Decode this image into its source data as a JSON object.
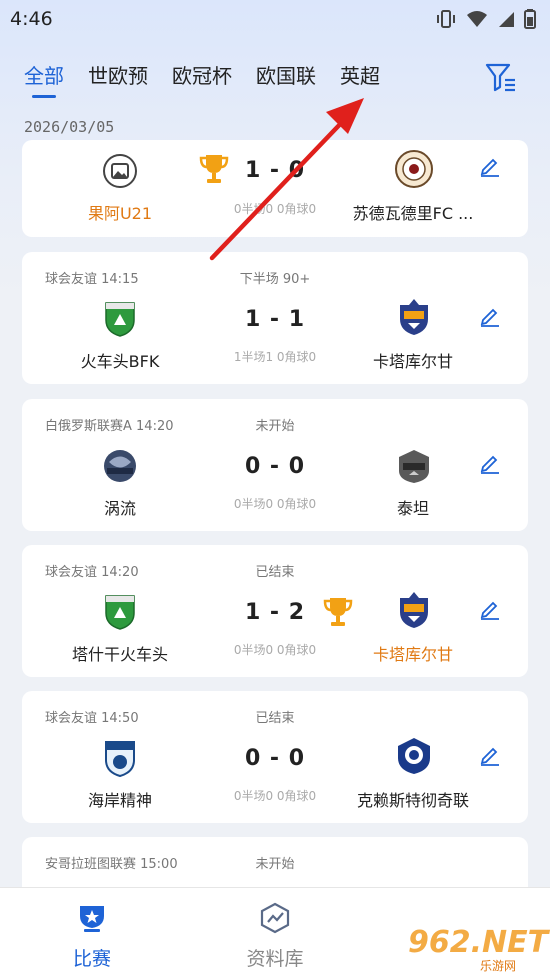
{
  "status_bar": {
    "time": "4:46"
  },
  "tabs": [
    {
      "label": "全部",
      "active": true
    },
    {
      "label": "世欧预",
      "active": false
    },
    {
      "label": "欧冠杯",
      "active": false
    },
    {
      "label": "欧国联",
      "active": false
    },
    {
      "label": "英超",
      "active": false
    }
  ],
  "date": "2026/03/05",
  "accent_color": "#1e63d6",
  "win_color": "#e07a14",
  "matches": [
    {
      "league": "",
      "status": "",
      "home": "果阿U21",
      "away": "苏德瓦德里FC ...",
      "score": "1 - 0",
      "stats": "0半场0 0角球0",
      "winner": "home"
    },
    {
      "league": "球会友谊 14:15",
      "status": "下半场 90+",
      "home": "火车头BFK",
      "away": "卡塔库尔甘",
      "score": "1 - 1",
      "stats": "1半场1 0角球0",
      "winner": ""
    },
    {
      "league": "白俄罗斯联赛A 14:20",
      "status": "未开始",
      "home": "涡流",
      "away": "泰坦",
      "score": "0 - 0",
      "stats": "0半场0 0角球0",
      "winner": ""
    },
    {
      "league": "球会友谊 14:20",
      "status": "已结束",
      "home": "塔什干火车头",
      "away": "卡塔库尔甘",
      "score": "1 - 2",
      "stats": "0半场0 0角球0",
      "winner": "away"
    },
    {
      "league": "球会友谊 14:50",
      "status": "已结束",
      "home": "海岸精神",
      "away": "克赖斯特彻奇联",
      "score": "0 - 0",
      "stats": "0半场0 0角球0",
      "winner": ""
    },
    {
      "league": "安哥拉班图联赛 15:00",
      "status": "未开始",
      "home": "",
      "away": "",
      "score": "",
      "stats": "",
      "winner": ""
    }
  ],
  "bottom_nav": [
    {
      "label": "比赛",
      "icon": "trophy-shield-icon",
      "active": true
    },
    {
      "label": "资料库",
      "icon": "database-chart-icon",
      "active": false
    }
  ],
  "watermark": {
    "main": "962.NET",
    "sub": "乐游网"
  }
}
